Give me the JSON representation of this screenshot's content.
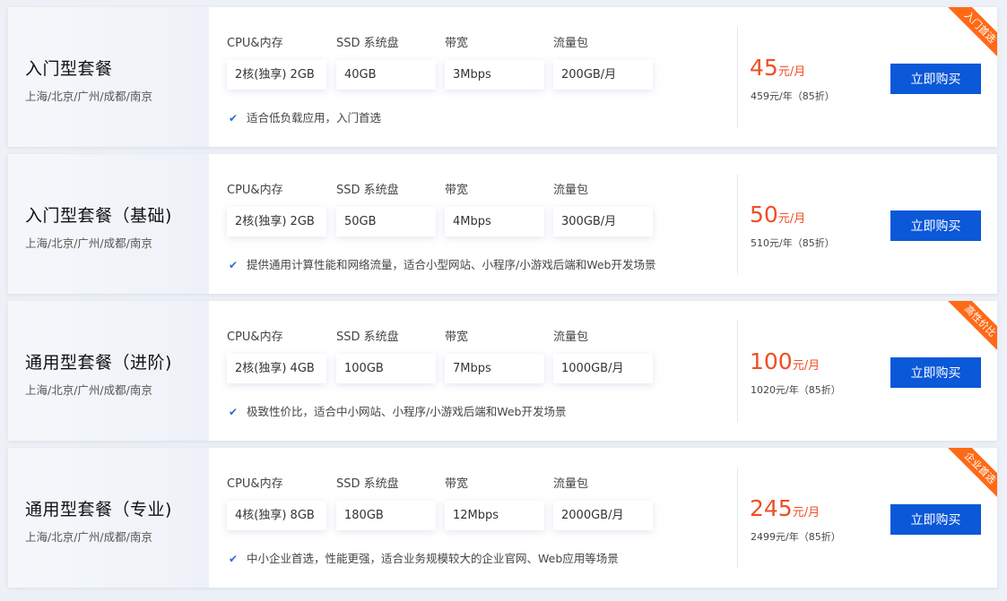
{
  "spec_labels": {
    "cpu": "CPU&内存",
    "ssd": "SSD 系统盘",
    "bandwidth": "带宽",
    "traffic": "流量包"
  },
  "buy_label": "立即购买",
  "check_icon": "✔",
  "plans": [
    {
      "name": "入门型套餐",
      "regions": "上海/北京/广州/成都/南京",
      "cpu": "2核(独享) 2GB",
      "ssd": "40GB",
      "bandwidth": "3Mbps",
      "traffic": "200GB/月",
      "feature": "适合低负载应用，入门首选",
      "price": "45",
      "price_unit": "元/月",
      "annual": "459元/年（85折）",
      "badge": "入门首选"
    },
    {
      "name": "入门型套餐（基础)",
      "regions": "上海/北京/广州/成都/南京",
      "cpu": "2核(独享) 2GB",
      "ssd": "50GB",
      "bandwidth": "4Mbps",
      "traffic": "300GB/月",
      "feature": "提供通用计算性能和网络流量，适合小型网站、小程序/小游戏后端和Web开发场景",
      "price": "50",
      "price_unit": "元/月",
      "annual": "510元/年（85折）",
      "badge": ""
    },
    {
      "name": "通用型套餐（进阶)",
      "regions": "上海/北京/广州/成都/南京",
      "cpu": "2核(独享) 4GB",
      "ssd": "100GB",
      "bandwidth": "7Mbps",
      "traffic": "1000GB/月",
      "feature": "极致性价比，适合中小网站、小程序/小游戏后端和Web开发场景",
      "price": "100",
      "price_unit": "元/月",
      "annual": "1020元/年（85折）",
      "badge": "高性价比"
    },
    {
      "name": "通用型套餐（专业)",
      "regions": "上海/北京/广州/成都/南京",
      "cpu": "4核(独享) 8GB",
      "ssd": "180GB",
      "bandwidth": "12Mbps",
      "traffic": "2000GB/月",
      "feature": "中小企业首选，性能更强，适合业务规模较大的企业官网、Web应用等场景",
      "price": "245",
      "price_unit": "元/月",
      "annual": "2499元/年（85折）",
      "badge": "企业首选"
    }
  ],
  "colors": {
    "accent": "#0b58d8",
    "price": "#f04e23",
    "badge": "#ff6a16"
  }
}
